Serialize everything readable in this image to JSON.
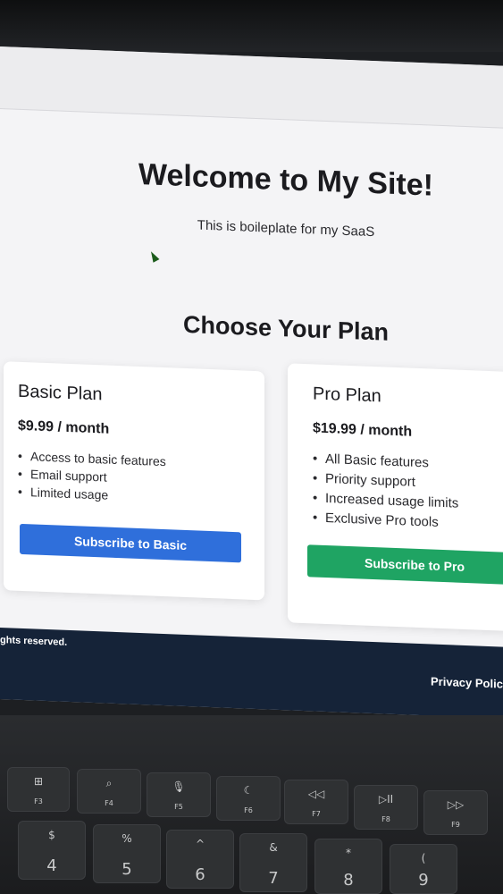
{
  "page": {
    "title": "Welcome to My Site!",
    "subtitle": "This is boileplate for my SaaS",
    "plans_heading": "Choose Your Plan"
  },
  "plans": {
    "basic": {
      "name": "Basic Plan",
      "price": "$9.99 / month",
      "features": [
        "Access to basic features",
        "Email support",
        "Limited usage"
      ],
      "button": "Subscribe to Basic",
      "button_color": "#2f6fdb"
    },
    "pro": {
      "name": "Pro Plan",
      "price": "$19.99 / month",
      "features": [
        "All Basic features",
        "Priority support",
        "Increased usage limits",
        "Exclusive Pro tools"
      ],
      "button": "Subscribe to Pro",
      "button_color": "#1fa463"
    }
  },
  "footer": {
    "rights": "ghts reserved.",
    "privacy": "Privacy Polic"
  },
  "keyboard": {
    "function_keys": [
      {
        "icon": "⊞",
        "label": "F3"
      },
      {
        "icon": "⌕",
        "label": "F4"
      },
      {
        "icon": "🎙",
        "label": "F5"
      },
      {
        "icon": "☾",
        "label": "F6"
      },
      {
        "icon": "◁◁",
        "label": "F7"
      },
      {
        "icon": "▷II",
        "label": "F8"
      },
      {
        "icon": "▷▷",
        "label": "F9"
      }
    ],
    "number_keys": [
      {
        "symbol": "$",
        "number": "4"
      },
      {
        "symbol": "%",
        "number": "5"
      },
      {
        "symbol": "^",
        "number": "6"
      },
      {
        "symbol": "&",
        "number": "7"
      },
      {
        "symbol": "*",
        "number": "8"
      },
      {
        "symbol": "(",
        "number": "9"
      }
    ]
  }
}
